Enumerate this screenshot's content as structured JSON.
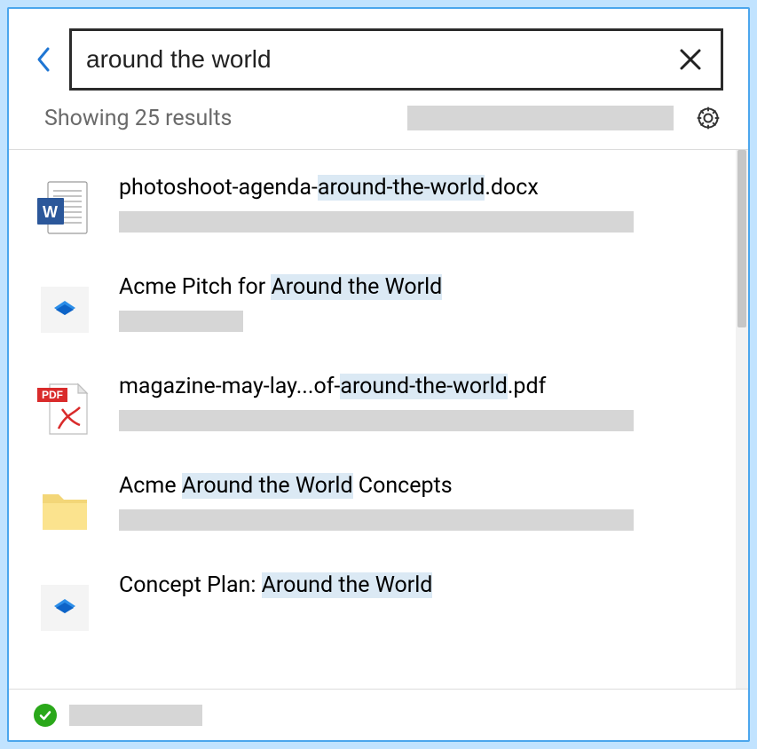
{
  "search": {
    "value": "around the world",
    "placeholder": ""
  },
  "results_summary": "Showing 25 results",
  "results": [
    {
      "icon": "docx",
      "title_parts": [
        {
          "text": "photoshoot-agenda-",
          "hl": false
        },
        {
          "text": "around-the-world",
          "hl": true
        },
        {
          "text": ".docx",
          "hl": false
        }
      ],
      "meta_width": "wide"
    },
    {
      "icon": "dropbox",
      "title_parts": [
        {
          "text": "Acme Pitch for ",
          "hl": false
        },
        {
          "text": "Around the World",
          "hl": true
        }
      ],
      "meta_width": "narrow"
    },
    {
      "icon": "pdf",
      "title_parts": [
        {
          "text": "magazine-may-lay...of-",
          "hl": false
        },
        {
          "text": "around-the-world",
          "hl": true
        },
        {
          "text": ".pdf",
          "hl": false
        }
      ],
      "meta_width": "wide"
    },
    {
      "icon": "folder",
      "title_parts": [
        {
          "text": "Acme ",
          "hl": false
        },
        {
          "text": "Around the World",
          "hl": true
        },
        {
          "text": " Concepts",
          "hl": false
        }
      ],
      "meta_width": "wide"
    },
    {
      "icon": "dropbox",
      "title_parts": [
        {
          "text": "Concept Plan: ",
          "hl": false
        },
        {
          "text": "Around the World",
          "hl": true
        }
      ],
      "meta_width": "wide"
    }
  ],
  "colors": {
    "highlight_bg": "#dbe9f4",
    "border": "#4ba6ed",
    "success": "#2aa81a"
  }
}
